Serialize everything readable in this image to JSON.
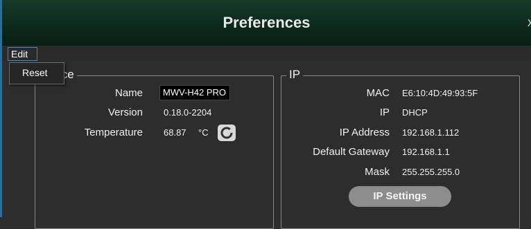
{
  "window": {
    "title": "Preferences",
    "close_glyph": "x"
  },
  "menu": {
    "edit_label": "Edit",
    "dropdown": {
      "items": [
        "Reset"
      ]
    }
  },
  "device": {
    "legend": "ice",
    "name_label": "Name",
    "name_value": "MWV-H42 PRO",
    "version_label": "Version",
    "version_value": "0.18.0-2204",
    "temperature_label": "Temperature",
    "temperature_value": "68.87",
    "temperature_unit": "°C",
    "refresh_icon": "refresh-icon"
  },
  "ip": {
    "legend": "IP",
    "mac_label": "MAC",
    "mac_value": "E6:10:4D:49:93:5F",
    "ip_label": "IP",
    "ip_value": "DHCP",
    "ip_address_label": "IP Address",
    "ip_address_value": "192.168.1.112",
    "gateway_label": "Default Gateway",
    "gateway_value": "192.168.1.1",
    "mask_label": "Mask",
    "mask_value": "255.255.255.0",
    "settings_button": "IP Settings"
  },
  "colors": {
    "title_bar": "#0d2a1c",
    "accent_border": "#2b6e99",
    "button": "#8c8c8c"
  }
}
